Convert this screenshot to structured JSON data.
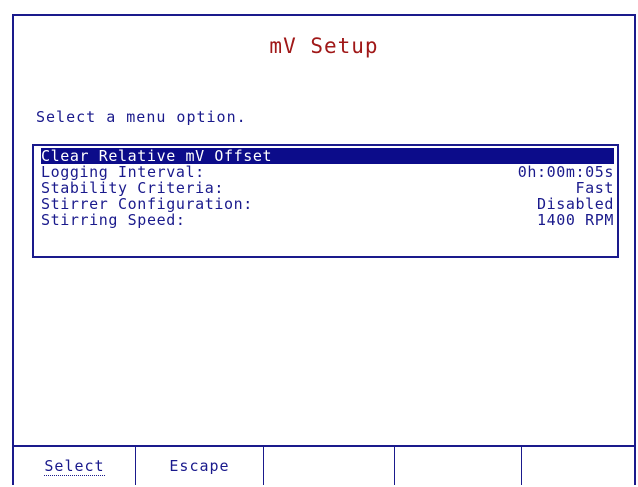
{
  "screen": {
    "title": "mV Setup",
    "prompt": "Select a menu option."
  },
  "menu": {
    "items": [
      {
        "label": "Clear Relative mV Offset",
        "value": "",
        "selected": true
      },
      {
        "label": "Logging Interval:",
        "value": "0h:00m:05s",
        "selected": false
      },
      {
        "label": "Stability Criteria:",
        "value": "Fast",
        "selected": false
      },
      {
        "label": "Stirrer Configuration:",
        "value": "Disabled",
        "selected": false
      },
      {
        "label": "Stirring Speed:",
        "value": "1400 RPM",
        "selected": false
      }
    ]
  },
  "softkeys": [
    {
      "label": "Select"
    },
    {
      "label": "Escape"
    },
    {
      "label": ""
    },
    {
      "label": ""
    },
    {
      "label": ""
    }
  ],
  "colors": {
    "title": "#a01818",
    "text": "#1a1a8c",
    "highlight": "#0c0c8a",
    "background": "#ffffff"
  }
}
